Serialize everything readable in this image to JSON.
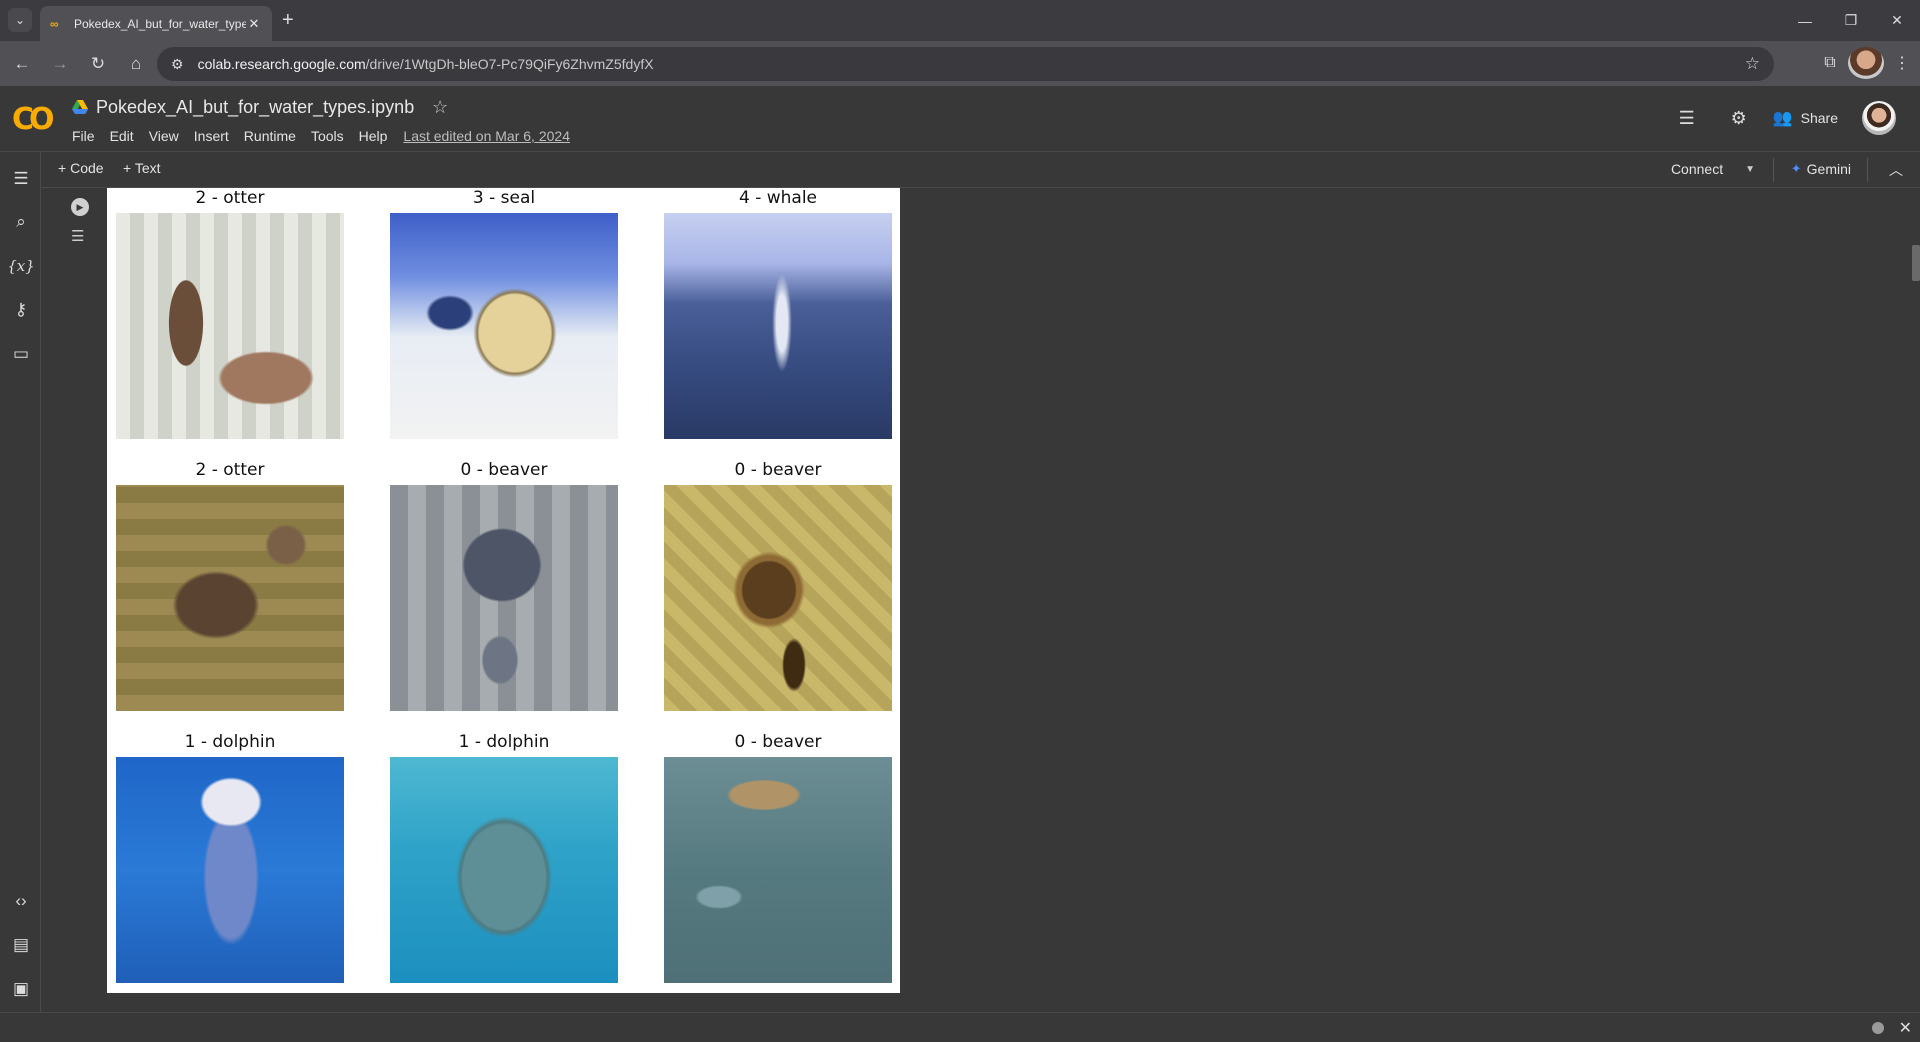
{
  "browser": {
    "tab_title": "Pokedex_AI_but_for_water_types.ipynb",
    "url_host": "colab.research.google.com",
    "url_path": "/drive/1WtgDh-bleO7-Pc79QiFy6ZhvmZ5fdyfX"
  },
  "colab": {
    "logo": "CO",
    "notebook_title": "Pokedex_AI_but_for_water_types.ipynb",
    "menu": [
      "File",
      "Edit",
      "View",
      "Insert",
      "Runtime",
      "Tools",
      "Help"
    ],
    "last_edited": "Last edited on Mar 6, 2024",
    "share_label": "Share",
    "add_code_label": "Code",
    "add_text_label": "Text",
    "connect_label": "Connect",
    "gemini_label": "Gemini"
  },
  "output": {
    "images": [
      {
        "label": "2 - otter",
        "icon": "otter-image"
      },
      {
        "label": "3 - seal",
        "icon": "seal-image"
      },
      {
        "label": "4 - whale",
        "icon": "whale-image"
      },
      {
        "label": "2 - otter",
        "icon": "otter-image"
      },
      {
        "label": "0 - beaver",
        "icon": "beaver-image"
      },
      {
        "label": "0 - beaver",
        "icon": "beaver-image"
      },
      {
        "label": "1 - dolphin",
        "icon": "dolphin-image"
      },
      {
        "label": "1 - dolphin",
        "icon": "dolphin-image"
      },
      {
        "label": "0 - beaver",
        "icon": "beaver-image"
      }
    ]
  },
  "colors": {
    "colab_orange": "#f9ab00",
    "gemini_blue": "#4c8df6",
    "background": "#383838"
  }
}
